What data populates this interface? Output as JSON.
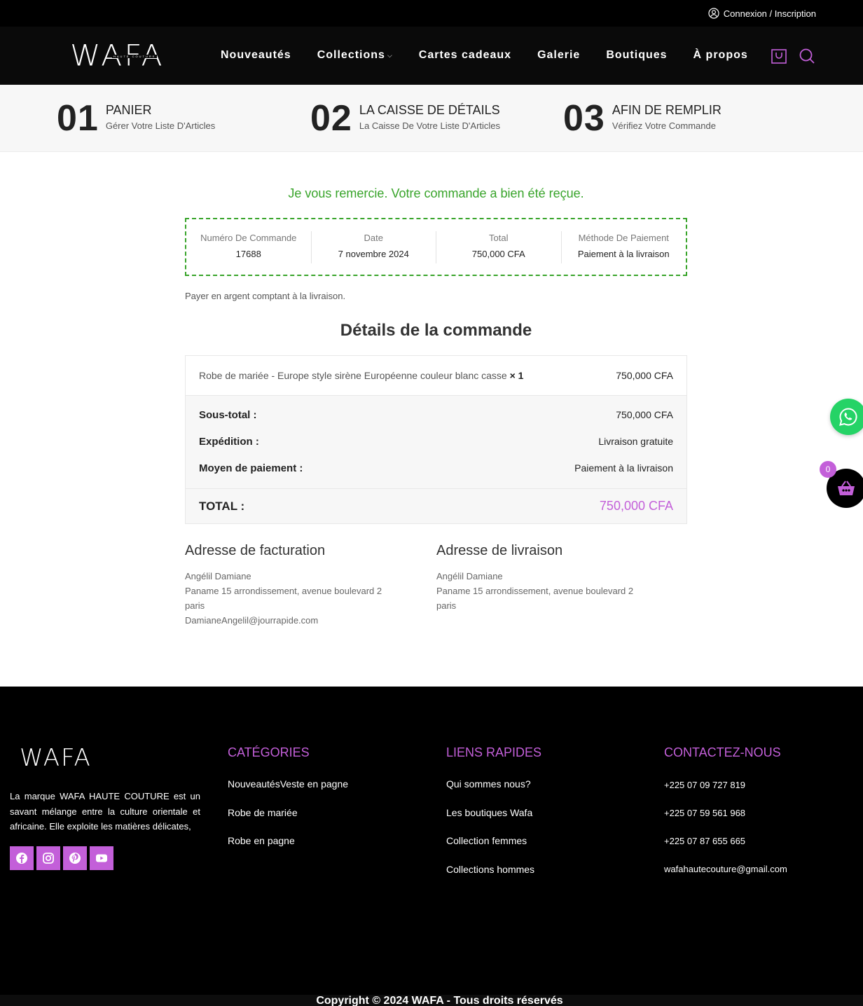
{
  "topbar": {
    "login": "Connexion / Inscription"
  },
  "header": {
    "logo": "WAFA",
    "logo_sub": "HAUTE COUTURE",
    "nav": [
      "Nouveautés",
      "Collections",
      "Cartes cadeaux",
      "Galerie",
      "Boutiques",
      "À propos"
    ],
    "accent": "#c35fd9"
  },
  "steps": [
    {
      "num": "01",
      "title": "PANIER",
      "sub": "Gérer Votre Liste D'Articles"
    },
    {
      "num": "02",
      "title": "LA CAISSE DE DÉTAILS",
      "sub": "La Caisse De Votre Liste D'Articles"
    },
    {
      "num": "03",
      "title": "AFIN DE REMPLIR",
      "sub": "Vérifiez Votre Commande"
    }
  ],
  "thanks": "Je vous remercie. Votre commande a bien été reçue.",
  "summary": {
    "order_label": "Numéro De Commande",
    "order_value": "17688",
    "date_label": "Date",
    "date_value": "7 novembre 2024",
    "total_label": "Total",
    "total_value": "750,000 CFA",
    "method_label": "Méthode De Paiement",
    "method_value": "Paiement à la livraison"
  },
  "pay_note": "Payer en argent comptant à la livraison.",
  "details_title": "Détails de la commande",
  "order": {
    "item_name": "Robe de mariée - Europe style sirène Européenne couleur blanc casse",
    "item_qty": "× 1",
    "item_price": "750,000 CFA",
    "subtotal_label": "Sous-total :",
    "subtotal_value": "750,000 CFA",
    "shipping_label": "Expédition :",
    "shipping_value": "Livraison gratuite",
    "payment_label": "Moyen de paiement :",
    "payment_value": "Paiement à la livraison",
    "total_label": "TOTAL :",
    "total_value": "750,000 CFA"
  },
  "billing": {
    "title": "Adresse de facturation",
    "name": "Angélil Damiane",
    "street": "Paname 15 arrondissement, avenue boulevard 2",
    "city": "paris",
    "email": "DamianeAngelil@jourrapide.com"
  },
  "shipping": {
    "title": "Adresse de livraison",
    "name": "Angélil Damiane",
    "street": "Paname 15 arrondissement, avenue boulevard 2",
    "city": "paris"
  },
  "cart_badge": "0",
  "footer": {
    "logo": "WAFA",
    "about": "La marque WAFA HAUTE COUTURE est un savant mélange entre la culture orientale et africaine. Elle exploite les matières délicates,",
    "categories_title": "CATÉGORIES",
    "categories": [
      "NouveautésVeste en pagne",
      "Robe de mariée",
      "Robe en pagne"
    ],
    "links_title": "LIENS RAPIDES",
    "links": [
      "Qui sommes nous?",
      "Les boutiques Wafa",
      "Collection femmes",
      "Collections hommes"
    ],
    "contact_title": "CONTACTEZ-NOUS",
    "contacts": [
      "+225 07 09 727 819",
      "+225 07 59 561 968",
      "+225 07 87 655 665",
      "wafahautecouture@gmail.com"
    ],
    "copyright": "Copyright © 2024 WAFA - Tous droits réservés"
  }
}
